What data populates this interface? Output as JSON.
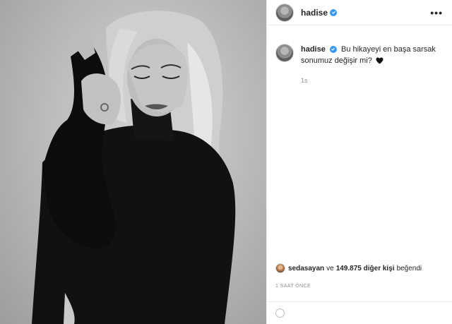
{
  "post": {
    "username": "hadise",
    "verified": true,
    "more_label": "•••",
    "caption_text": "Bu hikayeyi en başa sarsak sonumuz değişir mi?",
    "caption_emoji": "black-heart-icon",
    "caption_age": "1s",
    "likes": {
      "liker": "sedasayan",
      "connector": "ve",
      "count_text": "149.875 diğer kişi",
      "suffix": "beğendi"
    },
    "timestamp": "1 SAAT ÖNCE"
  },
  "colors": {
    "verified": "#3897f0",
    "secondary_text": "#8e8e8e",
    "border": "#efefef"
  }
}
